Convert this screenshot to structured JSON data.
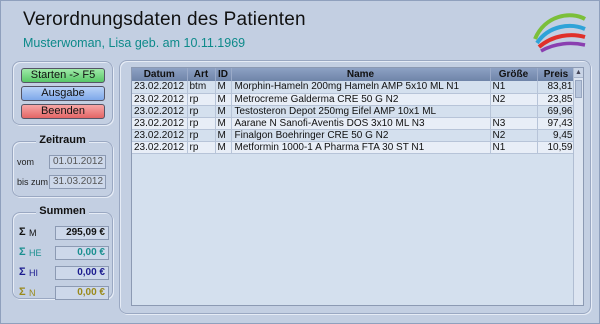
{
  "header": {
    "title": "Verordnungsdaten des Patienten",
    "subtitle": "Musterwoman, Lisa geb. am 10.11.1969"
  },
  "buttons": {
    "start_label": "Starten -> F5",
    "output_label": "Ausgabe",
    "exit_label": "Beenden"
  },
  "zeitraum": {
    "title": "Zeitraum",
    "from_label": "vom",
    "from_value": "01.01.2012",
    "to_label": "bis zum",
    "to_value": "31.03.2012"
  },
  "summen": {
    "title": "Summen",
    "rows": [
      {
        "sigma": "Σ",
        "label": "M",
        "value": "295,09 €",
        "color": "#111111"
      },
      {
        "sigma": "Σ",
        "label": "HE",
        "value": "0,00 €",
        "color": "#1a8f8f"
      },
      {
        "sigma": "Σ",
        "label": "HI",
        "value": "0,00 €",
        "color": "#1a1a8f"
      },
      {
        "sigma": "Σ",
        "label": "N",
        "value": "0,00 €",
        "color": "#9a8a1a"
      }
    ]
  },
  "table": {
    "columns": [
      "Datum",
      "Art",
      "ID",
      "Name",
      "Größe",
      "Preis"
    ],
    "rows": [
      [
        "23.02.2012",
        "btm",
        "M",
        "Morphin-Hameln 200mg Hameln AMP 5x10 ML N1",
        "N1",
        "83,81"
      ],
      [
        "23.02.2012",
        "rp",
        "M",
        "Metrocreme Galderma CRE 50 G N2",
        "N2",
        "23,85"
      ],
      [
        "23.02.2012",
        "rp",
        "M",
        "Testosteron Depot 250mg Eifel AMP 10x1 ML",
        "",
        "69,96"
      ],
      [
        "23.02.2012",
        "rp",
        "M",
        "Aarane N Sanofi-Aventis DOS 3x10 ML N3",
        "N3",
        "97,43"
      ],
      [
        "23.02.2012",
        "rp",
        "M",
        "Finalgon Boehringer CRE 50 G N2",
        "N2",
        "9,45"
      ],
      [
        "23.02.2012",
        "rp",
        "M",
        "Metformin 1000-1 A Pharma FTA 30 ST N1",
        "N1",
        "10,59"
      ]
    ]
  }
}
